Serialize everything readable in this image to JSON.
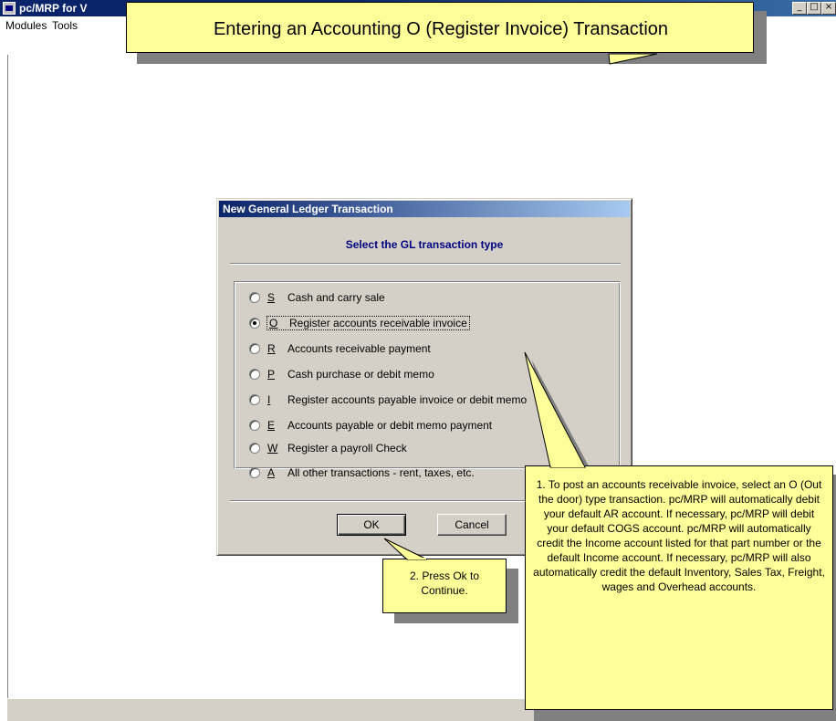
{
  "app": {
    "title": "pc/MRP for V",
    "menu": [
      "Modules",
      "Tools"
    ],
    "window_buttons": [
      "_",
      "□",
      "×"
    ]
  },
  "title_callout": {
    "text": "Entering an Accounting O (Register Invoice) Transaction"
  },
  "dialog": {
    "title": "New General Ledger Transaction",
    "heading": "Select the GL transaction type",
    "options": [
      {
        "key": "S",
        "label": "Cash and carry sale",
        "checked": false
      },
      {
        "key": "O",
        "label": "Register accounts receivable invoice",
        "checked": true
      },
      {
        "key": "R",
        "label": "Accounts receivable payment",
        "checked": false
      },
      {
        "key": "P",
        "label": "Cash purchase or debit memo",
        "checked": false
      },
      {
        "key": "I",
        "label": "Register accounts payable invoice or debit memo",
        "checked": false
      },
      {
        "key": "E",
        "label": "Accounts payable or debit memo payment",
        "checked": false
      },
      {
        "key": "W",
        "label": "Register a payroll Check",
        "checked": false
      },
      {
        "key": "A",
        "label": "All other transactions - rent, taxes, etc.",
        "checked": false
      }
    ],
    "buttons": {
      "ok": "OK",
      "cancel": "Cancel"
    }
  },
  "callouts": {
    "step1": "1.  To post an accounts receivable invoice, select an O (Out the door) type transaction.   pc/MRP will automatically debit your default AR account.  If necessary, pc/MRP will debit your default COGS account.  pc/MRP will automatically credit the Income account listed for that part number or the default Income account.   If necessary, pc/MRP will also automatically credit the default Inventory,  Sales Tax, Freight, wages and Overhead accounts.",
    "step2": "2.  Press Ok to Continue."
  },
  "colors": {
    "callout": "#ffff99",
    "titlebar": "#0a246a",
    "dialog_bg": "#d4d0c8",
    "heading": "#000080"
  }
}
